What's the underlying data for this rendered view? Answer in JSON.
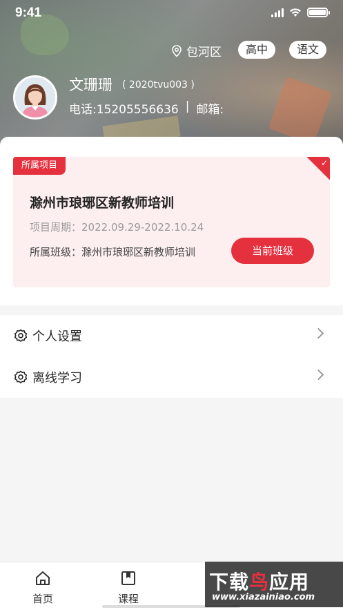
{
  "status_bar": {
    "time": "9:41"
  },
  "header": {
    "location": "包河区",
    "level": "高中",
    "subject": "语文"
  },
  "profile": {
    "name": "文珊珊",
    "user_id": "( 2020tvu003 )",
    "phone": "电话:15205556636",
    "separator": "|",
    "email": "邮箱:"
  },
  "project": {
    "tag": "所属项目",
    "title": "滁州市琅琊区新教师培训",
    "period": "项目周期：2022.09.29-2022.10.24",
    "class": "所属班级：滁州市琅琊区新教师培训",
    "current_button": "当前班级"
  },
  "settings": {
    "items": [
      {
        "label": "个人设置"
      },
      {
        "label": "离线学习"
      }
    ]
  },
  "tabs": [
    {
      "label": "首页",
      "icon": "home-icon"
    },
    {
      "label": "课程",
      "icon": "book-icon"
    }
  ],
  "watermark": {
    "line1_a": "下载",
    "line1_b": "鸟",
    "line1_c": "应用",
    "line2": "www.xiazainiao.com"
  },
  "colors": {
    "accent": "#e5303e",
    "card_bg": "#fdeff0"
  }
}
